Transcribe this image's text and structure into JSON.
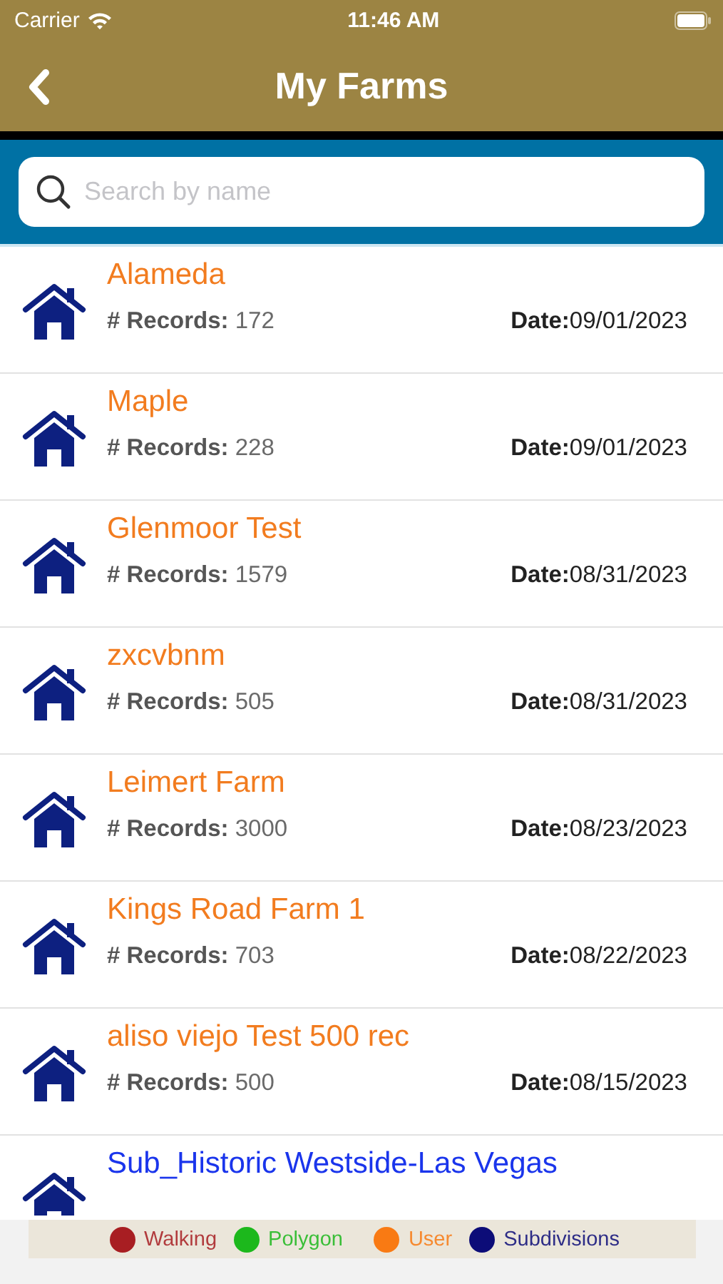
{
  "status_bar": {
    "carrier": "Carrier",
    "time": "11:46 AM"
  },
  "nav": {
    "title": "My Farms"
  },
  "search": {
    "placeholder": "Search by name"
  },
  "farms": [
    {
      "name": "Alameda",
      "color": "#f27c1f",
      "records_label": "# Records:",
      "records": "172",
      "date_label": "Date:",
      "date": "09/01/2023"
    },
    {
      "name": "Maple",
      "color": "#f27c1f",
      "records_label": "# Records:",
      "records": "228",
      "date_label": "Date:",
      "date": "09/01/2023"
    },
    {
      "name": "Glenmoor Test",
      "color": "#f27c1f",
      "records_label": "# Records:",
      "records": "1579",
      "date_label": "Date:",
      "date": "08/31/2023"
    },
    {
      "name": "zxcvbnm",
      "color": "#f27c1f",
      "records_label": "# Records:",
      "records": "505",
      "date_label": "Date:",
      "date": "08/31/2023"
    },
    {
      "name": "Leimert Farm",
      "color": "#f27c1f",
      "records_label": "# Records:",
      "records": "3000",
      "date_label": "Date:",
      "date": "08/23/2023"
    },
    {
      "name": "Kings Road Farm 1",
      "color": "#f27c1f",
      "records_label": "# Records:",
      "records": "703",
      "date_label": "Date:",
      "date": "08/22/2023"
    },
    {
      "name": "aliso viejo Test 500 rec",
      "color": "#f27c1f",
      "records_label": "# Records:",
      "records": "500",
      "date_label": "Date:",
      "date": "08/15/2023"
    },
    {
      "name": "Sub_Historic Westside-Las Vegas",
      "color": "#1a35ec"
    }
  ],
  "legend": [
    {
      "label": "Walking",
      "color": "#a81e22"
    },
    {
      "label": "Polygon",
      "color": "#1cb81c"
    },
    {
      "label": "User",
      "color": "#f97a13"
    },
    {
      "label": "Subdivisions",
      "color": "#0c0c78"
    }
  ]
}
